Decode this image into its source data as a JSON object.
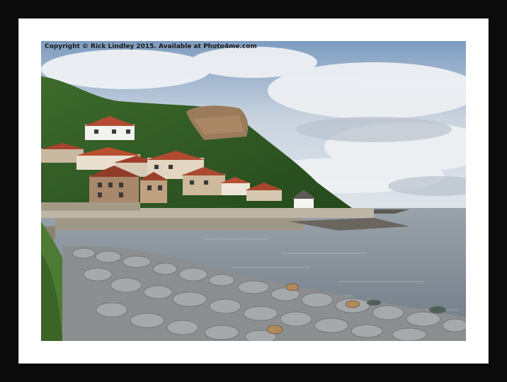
{
  "photo": {
    "caption": "Copyright © Rick Lindley 2015. Available at Photo4me.com"
  },
  "colors": {
    "frame": "#0b0b0b",
    "mount": "#ffffff",
    "sky": "#8aa8c8",
    "sea": "#8c96a0",
    "cliff": "#2f5a26"
  }
}
